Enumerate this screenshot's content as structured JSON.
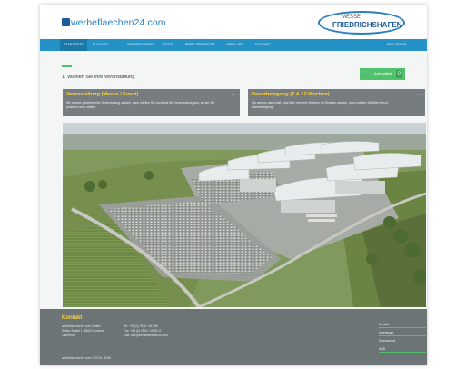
{
  "header": {
    "logo_text": "werbeflaechen24.com",
    "messe_line1": "MESSE",
    "messe_line2": "FRIEDRICHSHAFEN"
  },
  "nav": {
    "items": [
      "Startseite",
      "Flächen",
      "Werbeformen",
      "Fotos",
      "Preis Übersicht",
      "Über uns",
      "Kontakt"
    ],
    "login": "Einloggen"
  },
  "step": {
    "label": "1. Wählen Sie Ihre Veranstaltung"
  },
  "cart": {
    "label": "Auftragsliste",
    "count": "0"
  },
  "panels": [
    {
      "title": "Veranstaltung (Messe / Event)",
      "desc": "Sie werden gebeten eine Veranstaltung wählen, dann wählen Sie zunächst die Veranstaltung aus, an der Sie posieren auch stellen."
    },
    {
      "title": "Dauerbelegung (2 & 12 Wochen)",
      "desc": "Sie werden dauerhaft, sind über mehrere Wochen an Stunden werben, dann wählen Sie bitte hierzu: Dauerbelegung."
    }
  ],
  "footer": {
    "title": "Kontakt",
    "address": [
      "werbeflaechen24.com GmbH",
      "Spitze Straße 1, 88011 Lucerne",
      "Österreich"
    ],
    "contact": [
      "Tel.  +49 (0) 7576 / 45 555",
      "Fax:  +49 (0) 7576 / 45 55 11",
      "Mail: info@werbeflaechen24.com"
    ],
    "copyright": "werbeflaechen24.com © 2015 - 2016",
    "links": [
      "Kontakt",
      "Impressum",
      "Datenschutz",
      "AGB"
    ]
  },
  "colors": {
    "brand_blue": "#2491c7",
    "accent_green": "#4fc36b",
    "title_yellow": "#ffd43b",
    "panel_gray": "#767c7f",
    "footer_gray": "#6c7476"
  },
  "icons": {
    "cart": "shopping-cart-icon",
    "chevron": "chevron-down-icon"
  },
  "photo": {
    "subject": "aerial view of Messe Friedrichshafen exhibition halls and parking lots"
  }
}
